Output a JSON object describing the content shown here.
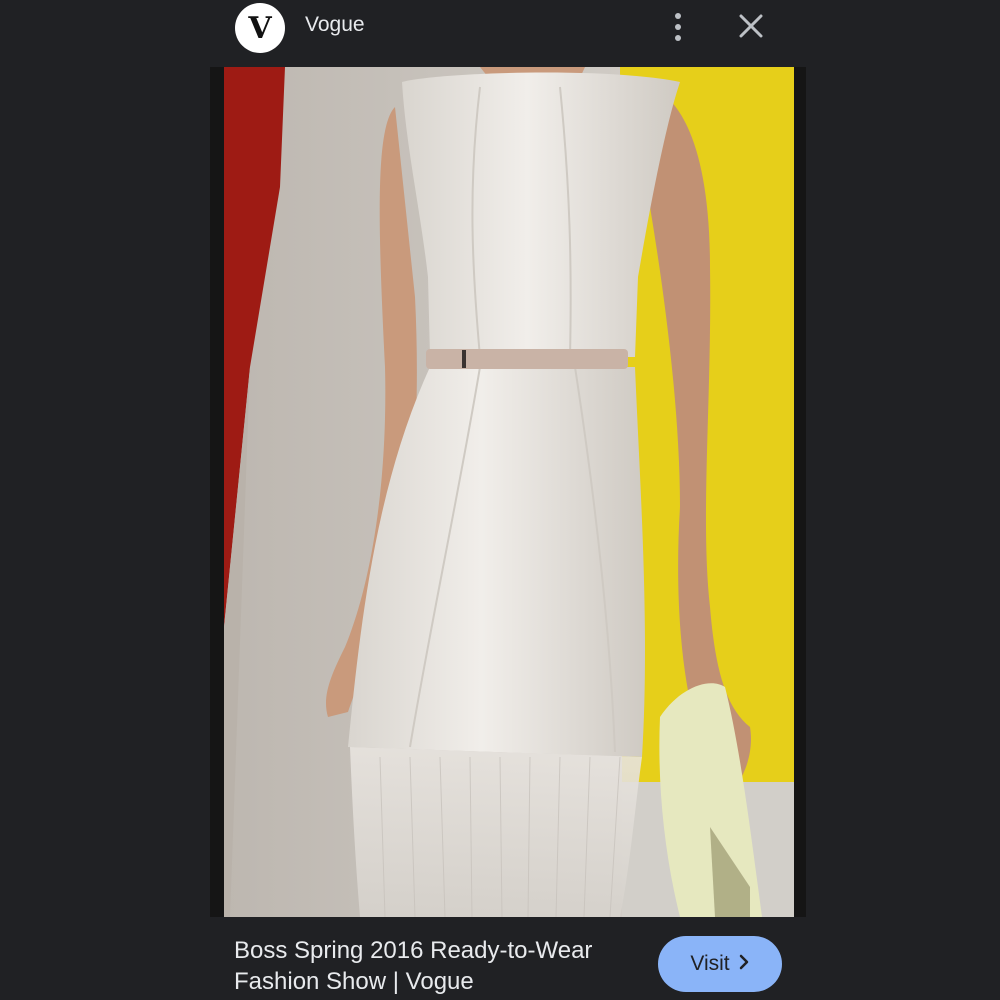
{
  "header": {
    "avatar_letter": "V",
    "source_name": "Vogue",
    "more_icon": "more-vert-icon",
    "close_icon": "close-icon"
  },
  "image": {
    "description_icon": "fashion-runway-photo",
    "colors": {
      "left_wall_red": "#9e1b14",
      "backdrop_gray": "#c9c5bf",
      "right_wall_yellow": "#e6cf1a",
      "dress_white": "#e9e6e1",
      "belt_pink": "#c9b3a6",
      "skin": "#c99a7c",
      "clutch": "#e6e8bf"
    }
  },
  "caption": {
    "title": "Boss Spring 2016 Ready-to-Wear Fashion Show | Vogue"
  },
  "actions": {
    "visit_label": "Visit",
    "visit_icon": "chevron-right-icon",
    "accent": "#8ab4f8"
  }
}
